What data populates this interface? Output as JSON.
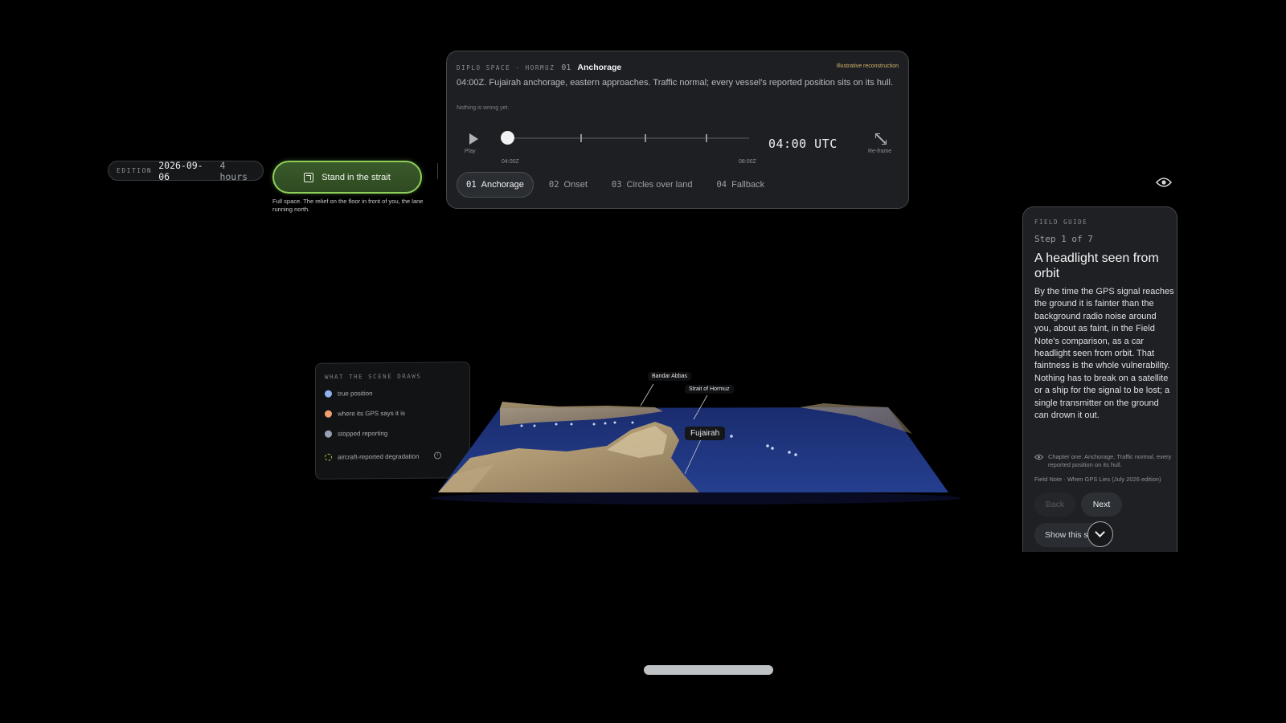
{
  "edition": {
    "label": "EDITION",
    "date": "2026-09-06",
    "duration": "4 hours"
  },
  "strait_button": {
    "label": "Stand in the strait",
    "caption": "Full space. The relief on the floor in front of you, the lane running north."
  },
  "top_card": {
    "brand": "DIPLO SPACE · HORMUZ",
    "chapter_number": "01",
    "chapter_title": "Anchorage",
    "badge": "Illustrative reconstruction",
    "description": "04:00Z. Fujairah anchorage, eastern approaches. Traffic normal; every vessel's reported position sits on its hull.",
    "subnote": "Nothing is wrong yet.",
    "play_label": "Play",
    "timeline_start": "04:00Z",
    "timeline_end": "08:00Z",
    "timeline_progress": 0,
    "time_readout": "04:00 UTC",
    "reframe_label": "Re-frame",
    "chapters": [
      {
        "num": "01",
        "label": "Anchorage",
        "active": true
      },
      {
        "num": "02",
        "label": "Onset",
        "active": false
      },
      {
        "num": "03",
        "label": "Circles over land",
        "active": false
      },
      {
        "num": "04",
        "label": "Fallback",
        "active": false
      }
    ]
  },
  "field_guide": {
    "kicker": "FIELD GUIDE",
    "step": "Step 1 of 7",
    "title": "A headlight seen from orbit",
    "body": "By the time the GPS signal reaches the ground it is fainter than the background radio noise around you, about as faint, in the Field Note's comparison, as a car headlight seen from orbit. That faintness is the whole vulnerability. Nothing has to break on a satellite or a ship for the signal to be lost; a single transmitter on the ground can drown it out.",
    "note": "Chapter one. Anchorage. Traffic normal, every reported position on its hull.",
    "source": "Field Note · When GPS Lies (July 2026 edition)",
    "back_label": "Back",
    "next_label": "Next",
    "show_label": "Show this s"
  },
  "legend": {
    "kicker": "WHAT THE SCENE DRAWS",
    "items": [
      {
        "label": "true position",
        "color": "#8fb4f0"
      },
      {
        "label": "where its GPS says it is",
        "color": "#f0a070"
      },
      {
        "label": "stopped reporting",
        "color": "#9aa0b4"
      },
      {
        "label": "aircraft-reported degradation",
        "color": "#c9d14a"
      }
    ]
  },
  "map": {
    "labels": {
      "bandar_abbas": "Bandar Abbas",
      "strait": "Strait of Hormuz",
      "fujairah": "Fujairah"
    }
  }
}
